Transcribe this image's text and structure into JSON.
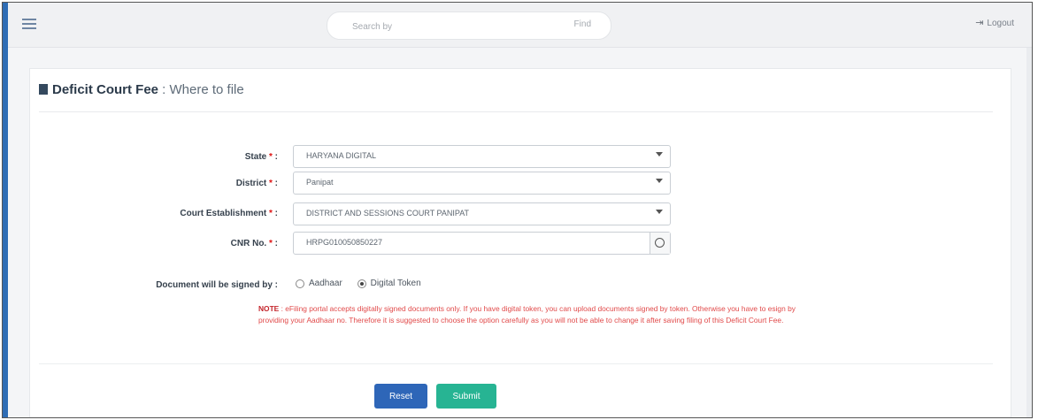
{
  "topbar": {
    "search_placeholder": "Search by",
    "search_button": "Find",
    "logout_label": "Logout"
  },
  "page": {
    "title_bold": "Deficit Court Fee",
    "title_rest": " : Where to file"
  },
  "form": {
    "state": {
      "label": "State",
      "value": "HARYANA DIGITAL"
    },
    "district": {
      "label": "District",
      "value": "Panipat"
    },
    "establishment": {
      "label": "Court Establishment",
      "value": "DISTRICT AND SESSIONS COURT PANIPAT"
    },
    "cnr": {
      "label": "CNR No.",
      "value": "HRPG010050850227"
    },
    "signed_by": {
      "label": "Document will be signed by",
      "options": [
        "Aadhaar",
        "Digital Token"
      ],
      "selected": "Digital Token"
    }
  },
  "note": {
    "prefix": "NOTE",
    "text": " : eFiling portal accepts digitally signed documents only. If you have digital token, you can upload documents signed by token. Otherwise you have to esign by providing your Aadhaar no. Therefore it is suggested to choose the option carefully as you will not be able to change it after saving filing of this Deficit Court Fee."
  },
  "buttons": {
    "reset": "Reset",
    "submit": "Submit"
  },
  "colors": {
    "reset_button": "#2e66b8",
    "submit_button": "#27b493",
    "note_text": "#e14a4a"
  }
}
